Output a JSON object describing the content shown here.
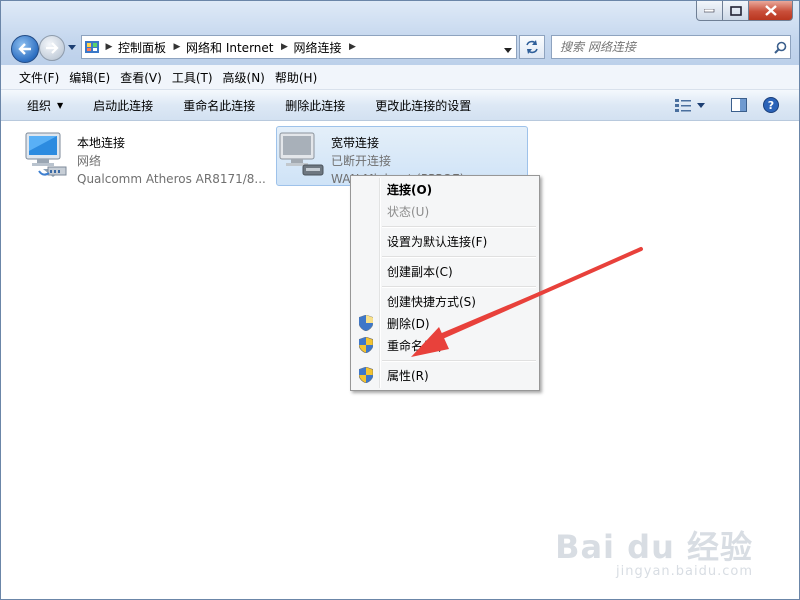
{
  "address": {
    "crumbs": [
      "控制面板",
      "网络和 Internet",
      "网络连接"
    ]
  },
  "search": {
    "placeholder": "搜索 网络连接"
  },
  "menu": [
    "文件(F)",
    "编辑(E)",
    "查看(V)",
    "工具(T)",
    "高级(N)",
    "帮助(H)"
  ],
  "toolbar": {
    "organize": "组织",
    "enable": "启动此连接",
    "rename": "重命名此连接",
    "delete": "删除此连接",
    "change": "更改此连接的设置"
  },
  "connections": [
    {
      "name": "本地连接",
      "status": "网络",
      "device": "Qualcomm Atheros AR8171/8..."
    },
    {
      "name": "宽带连接",
      "status": "已断开连接",
      "device": "WAN Miniport (PPPOE)"
    }
  ],
  "context_menu": {
    "connect": "连接(O)",
    "status": "状态(U)",
    "set_default": "设置为默认连接(F)",
    "create_copy": "创建副本(C)",
    "create_shortcut": "创建快捷方式(S)",
    "delete": "删除(D)",
    "rename": "重命名(M)",
    "properties": "属性(R)"
  },
  "watermark": {
    "brand": "Bai du 经验",
    "url": "jingyan.baidu.com"
  },
  "colors": {
    "annotation_arrow": "#e8413b",
    "toolbar_gradient_top": "#f5f9fd",
    "selection": "#cfe3f7"
  }
}
